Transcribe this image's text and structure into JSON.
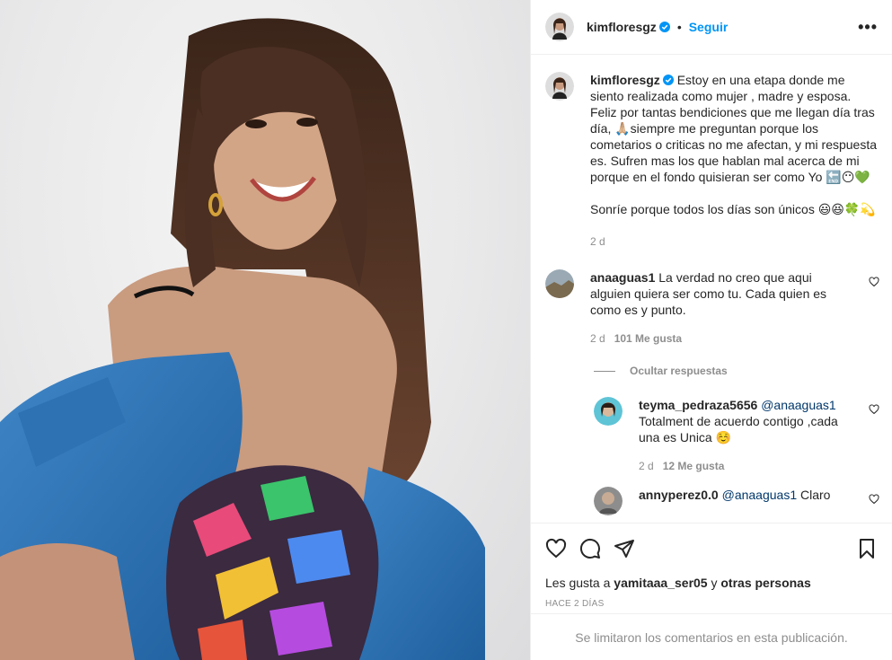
{
  "post": {
    "author": "kimfloresgz",
    "follow_label": "Seguir",
    "dot": "•",
    "more_label": "•••"
  },
  "caption": {
    "username": "kimfloresgz",
    "text_1": "Estoy en una etapa donde me siento realizada como mujer , madre y esposa. Feliz por tantas bendiciones que me llegan día tras día, 🙏🏼siempre me preguntan porque los cometarios o criticas no me afectan, y mi respuesta es. Sufren mas los que hablan mal acerca de mi porque en el fondo quisieran ser como Yo 🔚😶💚",
    "text_2": "Sonríe porque todos los días son únicos 😃😆🍀💫",
    "time": "2 d"
  },
  "comments": [
    {
      "username": "anaaguas1",
      "text": "La verdad no creo que aqui alguien quiera ser como tu. Cada quien es como es y punto.",
      "time": "2 d",
      "likes": "101 Me gusta"
    }
  ],
  "hide_replies_label": "Ocultar respuestas",
  "replies": [
    {
      "username": "teyma_pedraza5656",
      "mention": "@anaaguas1",
      "text": "Totalment de acuerdo contigo ,cada una es Unica ☺️",
      "time": "2 d",
      "likes": "12 Me gusta"
    },
    {
      "username": "annyperez0.0",
      "mention": "@anaaguas1",
      "text": "Claro"
    }
  ],
  "likes_line": {
    "prefix": "Les gusta a",
    "user": "yamitaaa_ser05",
    "joiner": "y",
    "others": "otras personas"
  },
  "posted_ago": "HACE 2 DÍAS",
  "comments_limited": "Se limitaron los comentarios en esta publicación.",
  "colors": {
    "accent": "#0095f6",
    "muted": "#8e8e8e",
    "border": "#efefef"
  },
  "icons": [
    "verified-icon",
    "more-icon",
    "heart-icon",
    "comment-icon",
    "share-icon",
    "save-icon"
  ]
}
